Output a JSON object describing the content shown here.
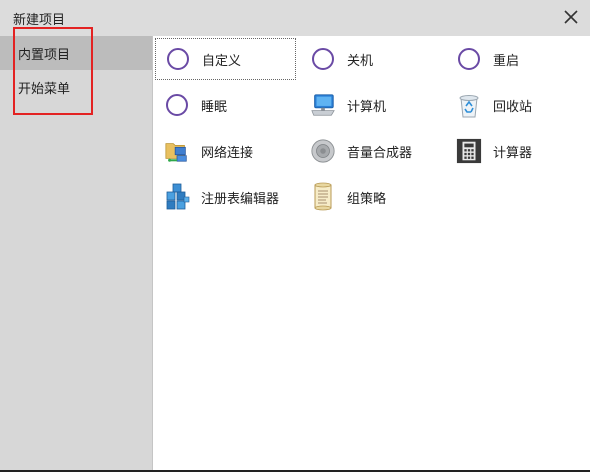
{
  "dialog": {
    "title": "新建项目",
    "close_icon": "close-icon"
  },
  "sidebar": {
    "items": [
      {
        "label": "内置项目",
        "active": true
      },
      {
        "label": "开始菜单",
        "active": false
      }
    ],
    "highlight_color": "#e32222"
  },
  "content": {
    "items": [
      {
        "label": "自定义",
        "icon": "ring-icon",
        "selected": true
      },
      {
        "label": "关机",
        "icon": "ring-icon"
      },
      {
        "label": "重启",
        "icon": "ring-icon"
      },
      {
        "label": "睡眠",
        "icon": "ring-icon"
      },
      {
        "label": "计算机",
        "icon": "computer-icon"
      },
      {
        "label": "回收站",
        "icon": "recycle-bin-icon"
      },
      {
        "label": "网络连接",
        "icon": "network-connections-icon"
      },
      {
        "label": "音量合成器",
        "icon": "speaker-icon"
      },
      {
        "label": "计算器",
        "icon": "calculator-icon"
      },
      {
        "label": "注册表编辑器",
        "icon": "registry-editor-icon"
      },
      {
        "label": "组策略",
        "icon": "group-policy-icon"
      }
    ]
  },
  "colors": {
    "ring": "#6a4aa5",
    "titlebar": "#dcdcdc",
    "sidebar": "#d7d7d7",
    "sidebar_active": "#bcbcbc"
  }
}
